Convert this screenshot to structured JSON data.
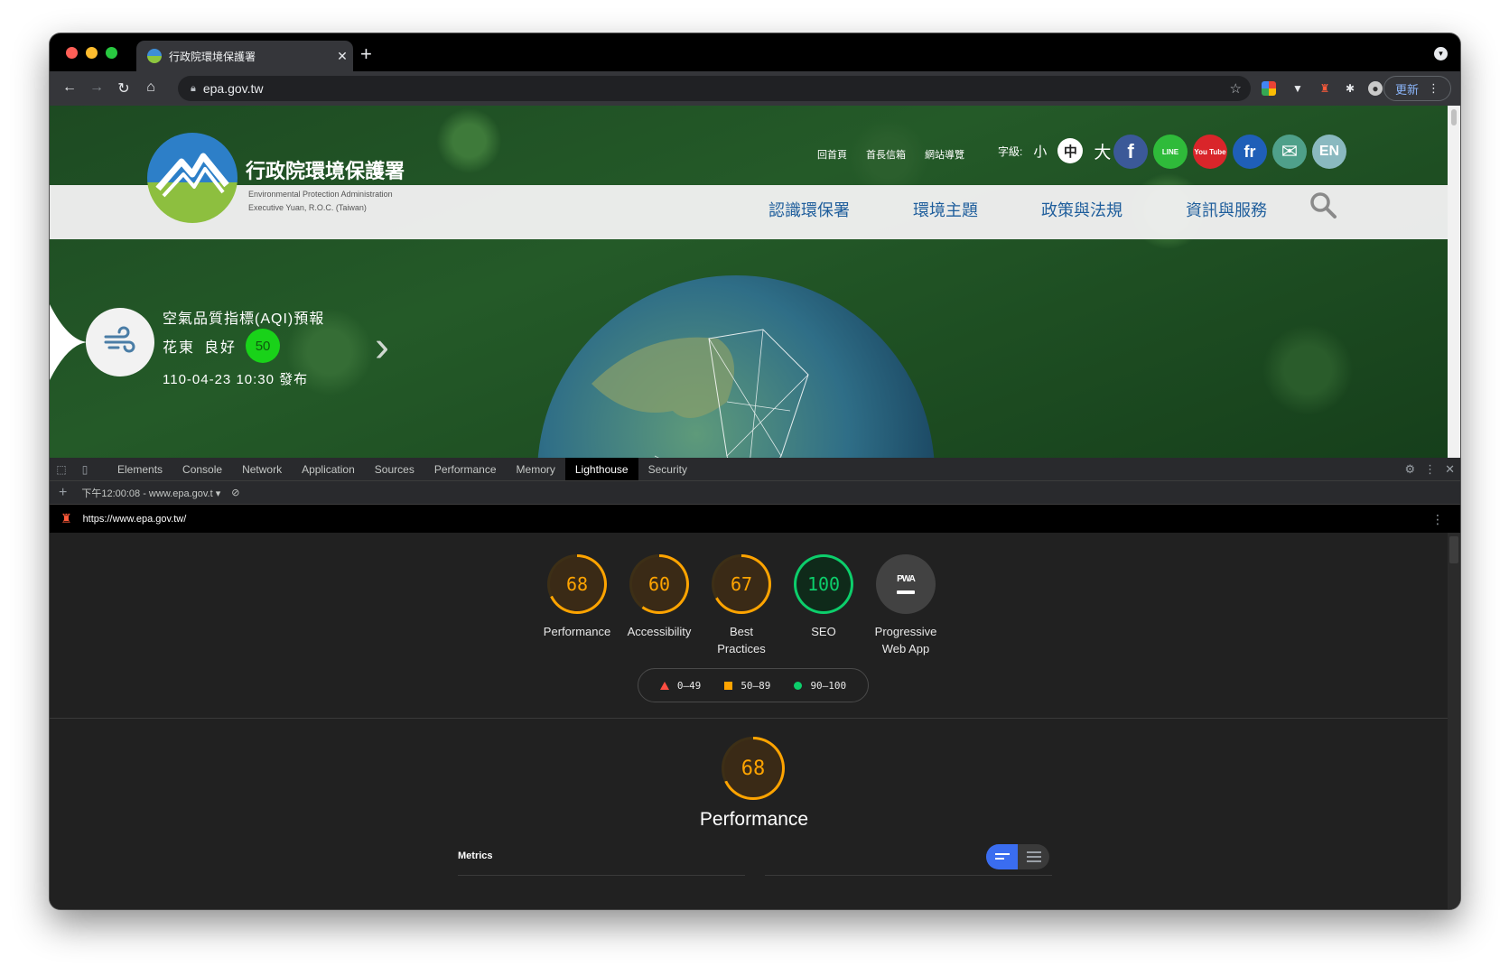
{
  "browser": {
    "tab_title": "行政院環境保護署",
    "url": "epa.gov.tw",
    "update_label": "更新"
  },
  "site": {
    "name": "行政院環境保護署",
    "subtitle_line1": "Environmental Protection Administration",
    "subtitle_line2": "Executive Yuan, R.O.C. (Taiwan)",
    "top_links": [
      "回首頁",
      "首長信箱",
      "網站導覽"
    ],
    "font_size_label": "字級:",
    "font_sizes": [
      "小",
      "中",
      "大"
    ],
    "social": [
      {
        "name": "facebook",
        "label": "f",
        "color": "#3b5998"
      },
      {
        "name": "line",
        "label": "LINE",
        "color": "#2fbb3a"
      },
      {
        "name": "youtube",
        "label": "You Tube",
        "color": "#d9252a"
      },
      {
        "name": "flickr",
        "label": "fr",
        "color": "#1f5fb8"
      },
      {
        "name": "email",
        "label": "✉",
        "color": "#4fa08a"
      },
      {
        "name": "english",
        "label": "EN",
        "color": "#8ab9c0"
      }
    ],
    "main_nav": [
      "認識環保署",
      "環境主題",
      "政策與法規",
      "資訊與服務"
    ],
    "aqi": {
      "title": "空氣品質指標(AQI)預報",
      "location": "花東",
      "status": "良好",
      "value": "50",
      "published": "110-04-23 10:30 發布"
    }
  },
  "devtools": {
    "tabs": [
      "Elements",
      "Console",
      "Network",
      "Application",
      "Sources",
      "Performance",
      "Memory",
      "Lighthouse",
      "Security"
    ],
    "active_tab": "Lighthouse",
    "report_selector": "下午12:00:08 - www.epa.gov.t",
    "report_url": "https://www.epa.gov.tw/"
  },
  "lighthouse": {
    "scores": [
      {
        "label": "Performance",
        "value": "68",
        "level": "average",
        "fraction": 0.68
      },
      {
        "label": "Accessibility",
        "value": "60",
        "level": "average",
        "fraction": 0.6
      },
      {
        "label": "Best\nPractices",
        "value": "67",
        "level": "average",
        "fraction": 0.67
      },
      {
        "label": "SEO",
        "value": "100",
        "level": "pass",
        "fraction": 1.0
      },
      {
        "label": "Progressive\nWeb App",
        "value": "",
        "level": "pwa",
        "badge": "PWA"
      }
    ],
    "legend": [
      {
        "range": "0–49",
        "color": "#ff4e42"
      },
      {
        "range": "50–89",
        "color": "#ffa400"
      },
      {
        "range": "90–100",
        "color": "#0cce6b"
      }
    ],
    "section_score": "68",
    "section_title": "Performance",
    "metrics_label": "Metrics"
  },
  "colors": {
    "average": "#ffa400",
    "pass": "#0cce6b",
    "fail": "#ff4e42"
  }
}
